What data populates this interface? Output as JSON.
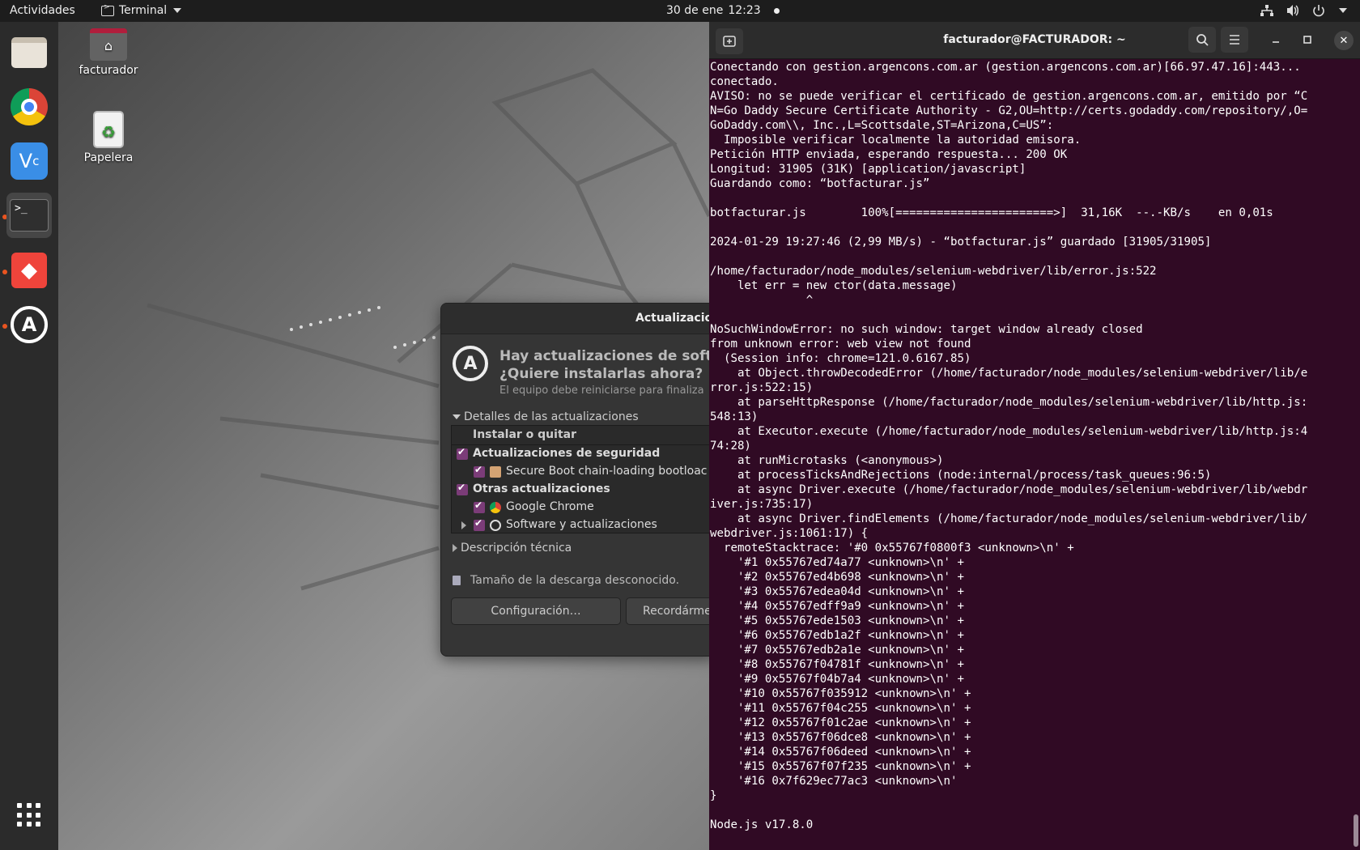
{
  "topbar": {
    "activities": "Actividades",
    "app_name": "Terminal",
    "date": "30 de ene",
    "time": "12:23"
  },
  "dock": {
    "items": [
      {
        "name": "files",
        "active": false
      },
      {
        "name": "google-chrome",
        "active": false
      },
      {
        "name": "vnc-viewer",
        "active": false
      },
      {
        "name": "terminal",
        "active": true
      },
      {
        "name": "anydesk",
        "active": false
      },
      {
        "name": "software-updater",
        "active": false
      }
    ]
  },
  "desktop": {
    "icons": [
      {
        "label": "facturador",
        "icon": "home-folder-icon"
      },
      {
        "label": "Papelera",
        "icon": "trash-icon"
      }
    ]
  },
  "update_dialog": {
    "title": "Actualizacion",
    "heading_line1": "Hay actualizaciones de softwar",
    "heading_line2": "¿Quiere instalarlas ahora?",
    "subtitle": "El equipo debe reiniciarse para finaliza",
    "details_expander": "Detalles de las actualizaciones",
    "column_header": "Instalar o quitar",
    "rows": [
      {
        "label": "Actualizaciones de seguridad",
        "level": 0,
        "bold": true,
        "icon": ""
      },
      {
        "label": "Secure Boot chain-loading bootloac",
        "level": 1,
        "bold": false,
        "icon": "package-icon"
      },
      {
        "label": "Otras actualizaciones",
        "level": 0,
        "bold": true,
        "icon": ""
      },
      {
        "label": "Google Chrome",
        "level": 1,
        "bold": false,
        "icon": "chrome-icon"
      },
      {
        "label": "Software y actualizaciones",
        "level": 1,
        "bold": false,
        "icon": "software-updater-icon"
      }
    ],
    "tech_expander": "Descripción técnica",
    "download_size": "Tamaño de la descarga desconocido.",
    "btn_config": "Configuración…",
    "btn_remind": "Recordárme"
  },
  "terminal": {
    "title": "facturador@FACTURADOR: ~",
    "lines": [
      "Conectando con gestion.argencons.com.ar (gestion.argencons.com.ar)[66.97.47.16]:443...",
      "conectado.",
      "AVISO: no se puede verificar el certificado de gestion.argencons.com.ar, emitido por “C",
      "N=Go Daddy Secure Certificate Authority - G2,OU=http://certs.godaddy.com/repository/,O=",
      "GoDaddy.com\\\\, Inc.,L=Scottsdale,ST=Arizona,C=US”:",
      "  Imposible verificar localmente la autoridad emisora.",
      "Petición HTTP enviada, esperando respuesta... 200 OK",
      "Longitud: 31905 (31K) [application/javascript]",
      "Guardando como: “botfacturar.js”",
      "",
      "botfacturar.js        100%[=======================>]  31,16K  --.-KB/s    en 0,01s",
      "",
      "2024-01-29 19:27:46 (2,99 MB/s) - “botfacturar.js” guardado [31905/31905]",
      "",
      "/home/facturador/node_modules/selenium-webdriver/lib/error.js:522",
      "    let err = new ctor(data.message)",
      "              ^",
      "",
      "NoSuchWindowError: no such window: target window already closed",
      "from unknown error: web view not found",
      "  (Session info: chrome=121.0.6167.85)",
      "    at Object.throwDecodedError (/home/facturador/node_modules/selenium-webdriver/lib/e",
      "rror.js:522:15)",
      "    at parseHttpResponse (/home/facturador/node_modules/selenium-webdriver/lib/http.js:",
      "548:13)",
      "    at Executor.execute (/home/facturador/node_modules/selenium-webdriver/lib/http.js:4",
      "74:28)",
      "    at runMicrotasks (<anonymous>)",
      "    at processTicksAndRejections (node:internal/process/task_queues:96:5)",
      "    at async Driver.execute (/home/facturador/node_modules/selenium-webdriver/lib/webdr",
      "iver.js:735:17)",
      "    at async Driver.findElements (/home/facturador/node_modules/selenium-webdriver/lib/",
      "webdriver.js:1061:17) {",
      "  remoteStacktrace: '#0 0x55767f0800f3 <unknown>\\n' +",
      "    '#1 0x55767ed74a77 <unknown>\\n' +",
      "    '#2 0x55767ed4b698 <unknown>\\n' +",
      "    '#3 0x55767edea04d <unknown>\\n' +",
      "    '#4 0x55767edff9a9 <unknown>\\n' +",
      "    '#5 0x55767ede1503 <unknown>\\n' +",
      "    '#6 0x55767edb1a2f <unknown>\\n' +",
      "    '#7 0x55767edb2a1e <unknown>\\n' +",
      "    '#8 0x55767f04781f <unknown>\\n' +",
      "    '#9 0x55767f04b7a4 <unknown>\\n' +",
      "    '#10 0x55767f035912 <unknown>\\n' +",
      "    '#11 0x55767f04c255 <unknown>\\n' +",
      "    '#12 0x55767f01c2ae <unknown>\\n' +",
      "    '#13 0x55767f06dce8 <unknown>\\n' +",
      "    '#14 0x55767f06deed <unknown>\\n' +",
      "    '#15 0x55767f07f235 <unknown>\\n' +",
      "    '#16 0x7f629ec77ac3 <unknown>\\n'",
      "}",
      "",
      "Node.js v17.8.0"
    ]
  }
}
